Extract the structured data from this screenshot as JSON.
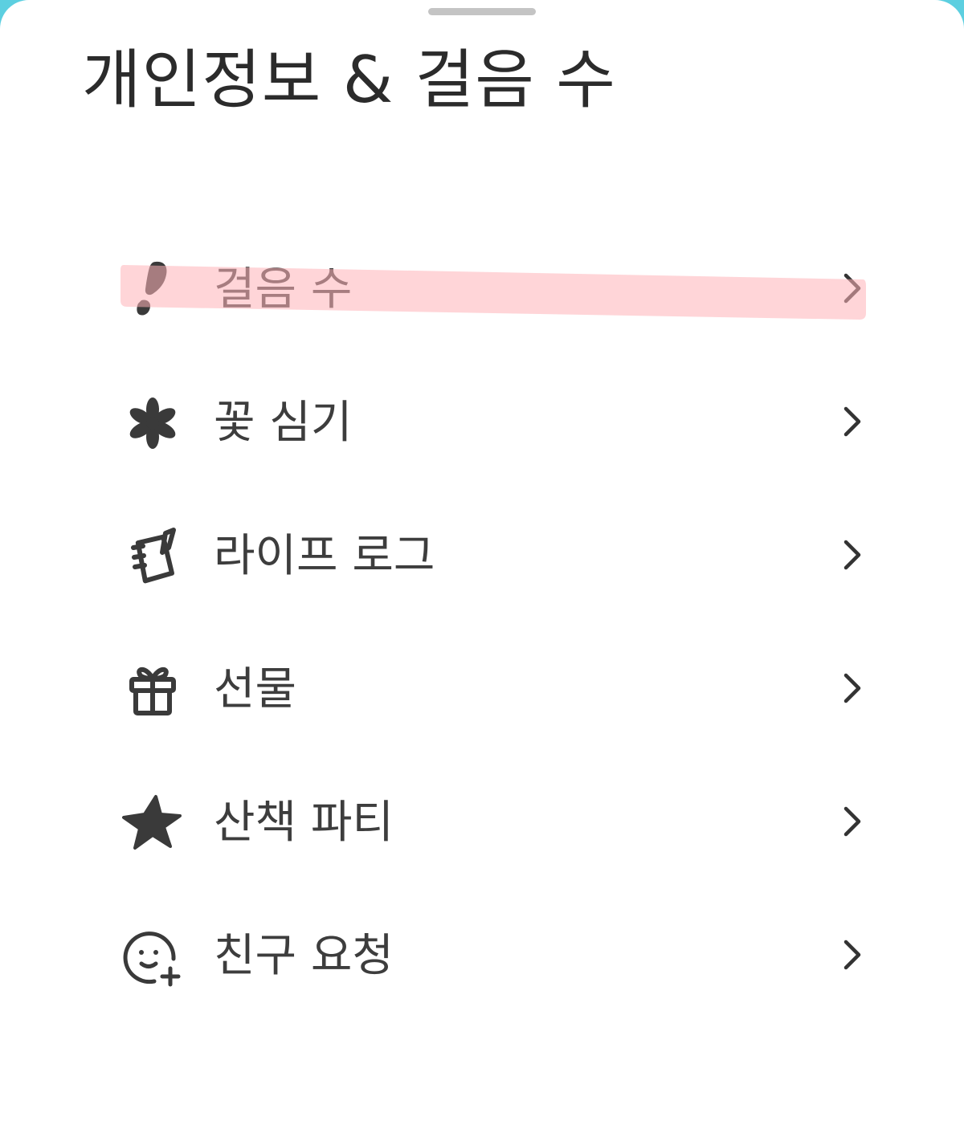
{
  "sheet": {
    "title": "개인정보 & 걸음 수"
  },
  "menu": {
    "items": [
      {
        "label": "걸음 수",
        "icon": "footprint-icon"
      },
      {
        "label": "꽃 심기",
        "icon": "flower-icon"
      },
      {
        "label": "라이프 로그",
        "icon": "notebook-icon"
      },
      {
        "label": "선물",
        "icon": "gift-icon"
      },
      {
        "label": "산책 파티",
        "icon": "star-icon"
      },
      {
        "label": "친구 요청",
        "icon": "add-friend-icon"
      }
    ]
  },
  "colors": {
    "background_accent": "#5ccfe0",
    "text": "#3d3d3d",
    "icon": "#3a3a3a",
    "highlight": "#ffb3b8"
  }
}
